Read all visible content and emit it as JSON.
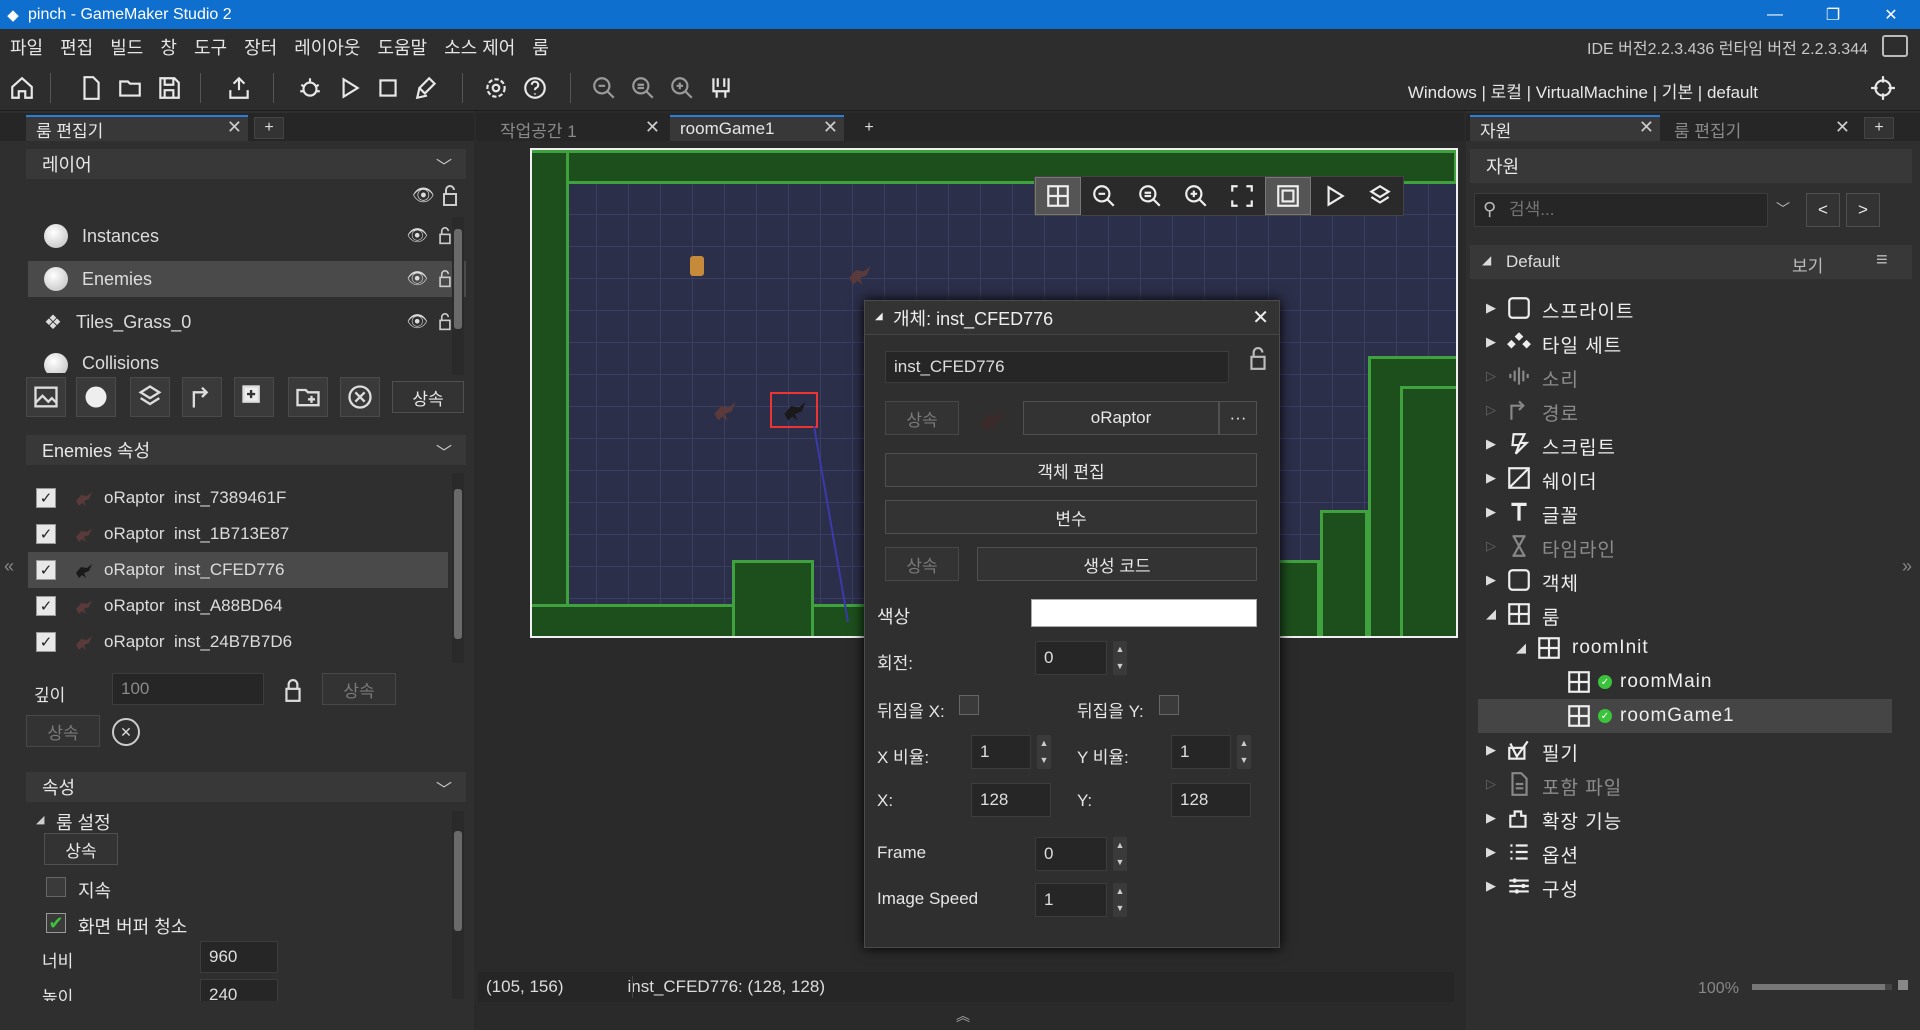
{
  "window": {
    "title": "pinch - GameMaker Studio 2",
    "minimize": "—",
    "restore": "❐",
    "close": "✕"
  },
  "menu": {
    "items": [
      "파일",
      "편집",
      "빌드",
      "창",
      "도구",
      "장터",
      "레이아웃",
      "도움말",
      "소스 제어",
      "룸"
    ],
    "version": "IDE 버전2.2.3.436 런타임 버전 2.2.3.344"
  },
  "toolbar": {
    "target": "Windows | 로컬 | VirtualMachine | 기본 | default",
    "icons": [
      "home-icon",
      "new-icon",
      "open-icon",
      "save-icon",
      "export-icon",
      "debug-icon",
      "run-icon",
      "stop-icon",
      "clean-icon",
      "settings-icon",
      "help-icon",
      "zoom-out-icon",
      "zoom-reset-icon",
      "zoom-in-icon",
      "gamepad-icon",
      "target-icon"
    ]
  },
  "left": {
    "tab": "룸 편집기",
    "tab_close": "✕",
    "tab_add": "+",
    "layers_header": "레이어",
    "layers": [
      {
        "name": "Instances",
        "selected": false
      },
      {
        "name": "Enemies",
        "selected": true
      },
      {
        "name": "Tiles_Grass_0",
        "selected": false
      },
      {
        "name": "Collisions",
        "selected": false
      }
    ],
    "inherit": "상속",
    "enemies_header": "Enemies 속성",
    "instances": [
      {
        "object": "oRaptor",
        "id": "inst_7389461F",
        "checked": true,
        "selected": false
      },
      {
        "object": "oRaptor",
        "id": "inst_1B713E87",
        "checked": true,
        "selected": false
      },
      {
        "object": "oRaptor",
        "id": "inst_CFED776",
        "checked": true,
        "selected": true
      },
      {
        "object": "oRaptor",
        "id": "inst_A88BD64",
        "checked": true,
        "selected": false
      },
      {
        "object": "oRaptor",
        "id": "inst_24B7B7D6",
        "checked": true,
        "selected": false
      }
    ],
    "depth_label": "깊이",
    "depth_value": "100",
    "props_header": "속성",
    "room_settings": "룸 설정",
    "persistent": "지속",
    "clear_buffer": "화면 버퍼 청소",
    "width_label": "너비",
    "width_value": "960",
    "height_label": "높이",
    "height_value": "240",
    "collapse": "«"
  },
  "center": {
    "tabs": [
      {
        "label": "작업공간 1",
        "active": false
      },
      {
        "label": "roomGame1",
        "active": true
      }
    ],
    "tab_add": "+",
    "status_coords": "(105, 156)",
    "status_inst": "inst_CFED776: (128, 128)",
    "bottom_arrow": "︽"
  },
  "popup": {
    "title": "개체: inst_CFED776",
    "name": "inst_CFED776",
    "inherit": "상속",
    "object": "oRaptor",
    "more": "···",
    "edit_object": "객체 편집",
    "variables": "변수",
    "creation_code": "생성 코드",
    "color_label": "색상",
    "color_value": "#ffffff",
    "rotation_label": "회전:",
    "rotation": "0",
    "flip_x": "뒤집을 X:",
    "flip_y": "뒤집을 Y:",
    "xscale_label": "X 비율:",
    "xscale": "1",
    "yscale_label": "Y 비율:",
    "yscale": "1",
    "x_label": "X:",
    "x": "128",
    "y_label": "Y:",
    "y": "128",
    "frame_label": "Frame",
    "frame": "0",
    "speed_label": "Image Speed",
    "speed": "1"
  },
  "right": {
    "tabs": [
      {
        "label": "자원",
        "active": true
      },
      {
        "label": "룸 편집기",
        "active": false
      }
    ],
    "tab_add": "+",
    "header": "자원",
    "search_placeholder": "검색...",
    "prev": "<",
    "next": ">",
    "group": "Default",
    "view": "보기",
    "tree": [
      {
        "label": "스프라이트",
        "icon": "sprite-icon",
        "dim": false,
        "indent": 0,
        "arrow": "▶"
      },
      {
        "label": "타일 세트",
        "icon": "tileset-icon",
        "dim": false,
        "indent": 0,
        "arrow": "▶"
      },
      {
        "label": "소리",
        "icon": "sound-icon",
        "dim": true,
        "indent": 0,
        "arrow": "▷"
      },
      {
        "label": "경로",
        "icon": "path-icon",
        "dim": true,
        "indent": 0,
        "arrow": "▷"
      },
      {
        "label": "스크립트",
        "icon": "script-icon",
        "dim": false,
        "indent": 0,
        "arrow": "▶"
      },
      {
        "label": "쉐이더",
        "icon": "shader-icon",
        "dim": false,
        "indent": 0,
        "arrow": "▶"
      },
      {
        "label": "글꼴",
        "icon": "font-icon",
        "dim": false,
        "indent": 0,
        "arrow": "▶"
      },
      {
        "label": "타임라인",
        "icon": "timeline-icon",
        "dim": true,
        "indent": 0,
        "arrow": "▷"
      },
      {
        "label": "객체",
        "icon": "object-icon",
        "dim": false,
        "indent": 0,
        "arrow": "▶"
      },
      {
        "label": "룸",
        "icon": "room-icon",
        "dim": false,
        "indent": 0,
        "arrow": "◢"
      },
      {
        "label": "roomInit",
        "icon": "room-icon",
        "dim": false,
        "indent": 1,
        "arrow": "◢"
      },
      {
        "label": "roomMain",
        "icon": "room-icon",
        "dim": false,
        "indent": 2,
        "arrow": ""
      },
      {
        "label": "roomGame1",
        "icon": "room-icon",
        "dim": false,
        "indent": 2,
        "arrow": "",
        "selected": true
      },
      {
        "label": "필기",
        "icon": "notes-icon",
        "dim": false,
        "indent": 0,
        "arrow": "▶"
      },
      {
        "label": "포함 파일",
        "icon": "included-files-icon",
        "dim": true,
        "indent": 0,
        "arrow": "▷"
      },
      {
        "label": "확장 기능",
        "icon": "extension-icon",
        "dim": false,
        "indent": 0,
        "arrow": "▶"
      },
      {
        "label": "옵션",
        "icon": "options-icon",
        "dim": false,
        "indent": 0,
        "arrow": "▶"
      },
      {
        "label": "구성",
        "icon": "config-icon",
        "dim": false,
        "indent": 0,
        "arrow": "▶"
      }
    ],
    "zoom": "100%",
    "zoom_level": 0.95,
    "collapse": "»"
  }
}
